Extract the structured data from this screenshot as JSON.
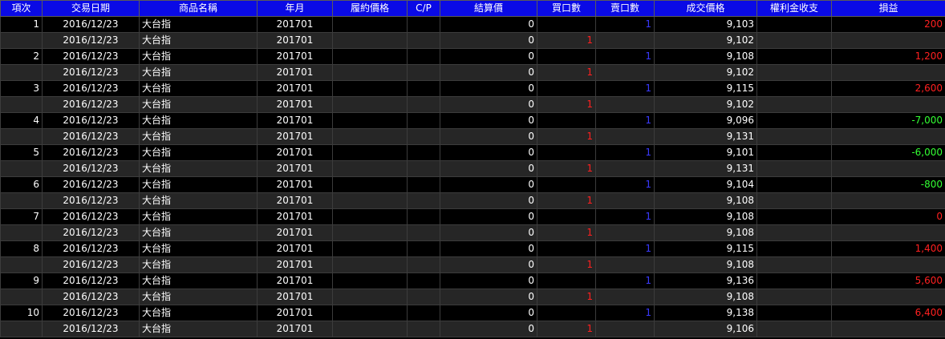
{
  "columns": [
    "項次",
    "交易日期",
    "商品名稱",
    "年月",
    "履約價格",
    "C/P",
    "結算價",
    "買口數",
    "賣口數",
    "成交價格",
    "權利金收支",
    "損益"
  ],
  "colors": {
    "header_bg": "#0a0ae6",
    "positive": "#ff2020",
    "negative": "#33ff33",
    "buy_qty": "#ff2020",
    "sell_qty": "#3a3aff"
  },
  "rows": [
    {
      "idx": "1",
      "date": "2016/12/23",
      "product": "大台指",
      "ym": "201701",
      "strike": "",
      "cp": "",
      "settle": "0",
      "buy": "",
      "sell": "1",
      "price": "9,103",
      "premium": "",
      "pnl": "200",
      "pnl_sign": "pos"
    },
    {
      "idx": "",
      "date": "2016/12/23",
      "product": "大台指",
      "ym": "201701",
      "strike": "",
      "cp": "",
      "settle": "0",
      "buy": "1",
      "sell": "",
      "price": "9,102",
      "premium": "",
      "pnl": "",
      "pnl_sign": ""
    },
    {
      "idx": "2",
      "date": "2016/12/23",
      "product": "大台指",
      "ym": "201701",
      "strike": "",
      "cp": "",
      "settle": "0",
      "buy": "",
      "sell": "1",
      "price": "9,108",
      "premium": "",
      "pnl": "1,200",
      "pnl_sign": "pos"
    },
    {
      "idx": "",
      "date": "2016/12/23",
      "product": "大台指",
      "ym": "201701",
      "strike": "",
      "cp": "",
      "settle": "0",
      "buy": "1",
      "sell": "",
      "price": "9,102",
      "premium": "",
      "pnl": "",
      "pnl_sign": ""
    },
    {
      "idx": "3",
      "date": "2016/12/23",
      "product": "大台指",
      "ym": "201701",
      "strike": "",
      "cp": "",
      "settle": "0",
      "buy": "",
      "sell": "1",
      "price": "9,115",
      "premium": "",
      "pnl": "2,600",
      "pnl_sign": "pos"
    },
    {
      "idx": "",
      "date": "2016/12/23",
      "product": "大台指",
      "ym": "201701",
      "strike": "",
      "cp": "",
      "settle": "0",
      "buy": "1",
      "sell": "",
      "price": "9,102",
      "premium": "",
      "pnl": "",
      "pnl_sign": ""
    },
    {
      "idx": "4",
      "date": "2016/12/23",
      "product": "大台指",
      "ym": "201701",
      "strike": "",
      "cp": "",
      "settle": "0",
      "buy": "",
      "sell": "1",
      "price": "9,096",
      "premium": "",
      "pnl": "-7,000",
      "pnl_sign": "neg"
    },
    {
      "idx": "",
      "date": "2016/12/23",
      "product": "大台指",
      "ym": "201701",
      "strike": "",
      "cp": "",
      "settle": "0",
      "buy": "1",
      "sell": "",
      "price": "9,131",
      "premium": "",
      "pnl": "",
      "pnl_sign": ""
    },
    {
      "idx": "5",
      "date": "2016/12/23",
      "product": "大台指",
      "ym": "201701",
      "strike": "",
      "cp": "",
      "settle": "0",
      "buy": "",
      "sell": "1",
      "price": "9,101",
      "premium": "",
      "pnl": "-6,000",
      "pnl_sign": "neg"
    },
    {
      "idx": "",
      "date": "2016/12/23",
      "product": "大台指",
      "ym": "201701",
      "strike": "",
      "cp": "",
      "settle": "0",
      "buy": "1",
      "sell": "",
      "price": "9,131",
      "premium": "",
      "pnl": "",
      "pnl_sign": ""
    },
    {
      "idx": "6",
      "date": "2016/12/23",
      "product": "大台指",
      "ym": "201701",
      "strike": "",
      "cp": "",
      "settle": "0",
      "buy": "",
      "sell": "1",
      "price": "9,104",
      "premium": "",
      "pnl": "-800",
      "pnl_sign": "neg"
    },
    {
      "idx": "",
      "date": "2016/12/23",
      "product": "大台指",
      "ym": "201701",
      "strike": "",
      "cp": "",
      "settle": "0",
      "buy": "1",
      "sell": "",
      "price": "9,108",
      "premium": "",
      "pnl": "",
      "pnl_sign": ""
    },
    {
      "idx": "7",
      "date": "2016/12/23",
      "product": "大台指",
      "ym": "201701",
      "strike": "",
      "cp": "",
      "settle": "0",
      "buy": "",
      "sell": "1",
      "price": "9,108",
      "premium": "",
      "pnl": "0",
      "pnl_sign": "pos"
    },
    {
      "idx": "",
      "date": "2016/12/23",
      "product": "大台指",
      "ym": "201701",
      "strike": "",
      "cp": "",
      "settle": "0",
      "buy": "1",
      "sell": "",
      "price": "9,108",
      "premium": "",
      "pnl": "",
      "pnl_sign": ""
    },
    {
      "idx": "8",
      "date": "2016/12/23",
      "product": "大台指",
      "ym": "201701",
      "strike": "",
      "cp": "",
      "settle": "0",
      "buy": "",
      "sell": "1",
      "price": "9,115",
      "premium": "",
      "pnl": "1,400",
      "pnl_sign": "pos"
    },
    {
      "idx": "",
      "date": "2016/12/23",
      "product": "大台指",
      "ym": "201701",
      "strike": "",
      "cp": "",
      "settle": "0",
      "buy": "1",
      "sell": "",
      "price": "9,108",
      "premium": "",
      "pnl": "",
      "pnl_sign": ""
    },
    {
      "idx": "9",
      "date": "2016/12/23",
      "product": "大台指",
      "ym": "201701",
      "strike": "",
      "cp": "",
      "settle": "0",
      "buy": "",
      "sell": "1",
      "price": "9,136",
      "premium": "",
      "pnl": "5,600",
      "pnl_sign": "pos"
    },
    {
      "idx": "",
      "date": "2016/12/23",
      "product": "大台指",
      "ym": "201701",
      "strike": "",
      "cp": "",
      "settle": "0",
      "buy": "1",
      "sell": "",
      "price": "9,108",
      "premium": "",
      "pnl": "",
      "pnl_sign": ""
    },
    {
      "idx": "10",
      "date": "2016/12/23",
      "product": "大台指",
      "ym": "201701",
      "strike": "",
      "cp": "",
      "settle": "0",
      "buy": "",
      "sell": "1",
      "price": "9,138",
      "premium": "",
      "pnl": "6,400",
      "pnl_sign": "pos"
    },
    {
      "idx": "",
      "date": "2016/12/23",
      "product": "大台指",
      "ym": "201701",
      "strike": "",
      "cp": "",
      "settle": "0",
      "buy": "1",
      "sell": "",
      "price": "9,106",
      "premium": "",
      "pnl": "",
      "pnl_sign": ""
    }
  ]
}
